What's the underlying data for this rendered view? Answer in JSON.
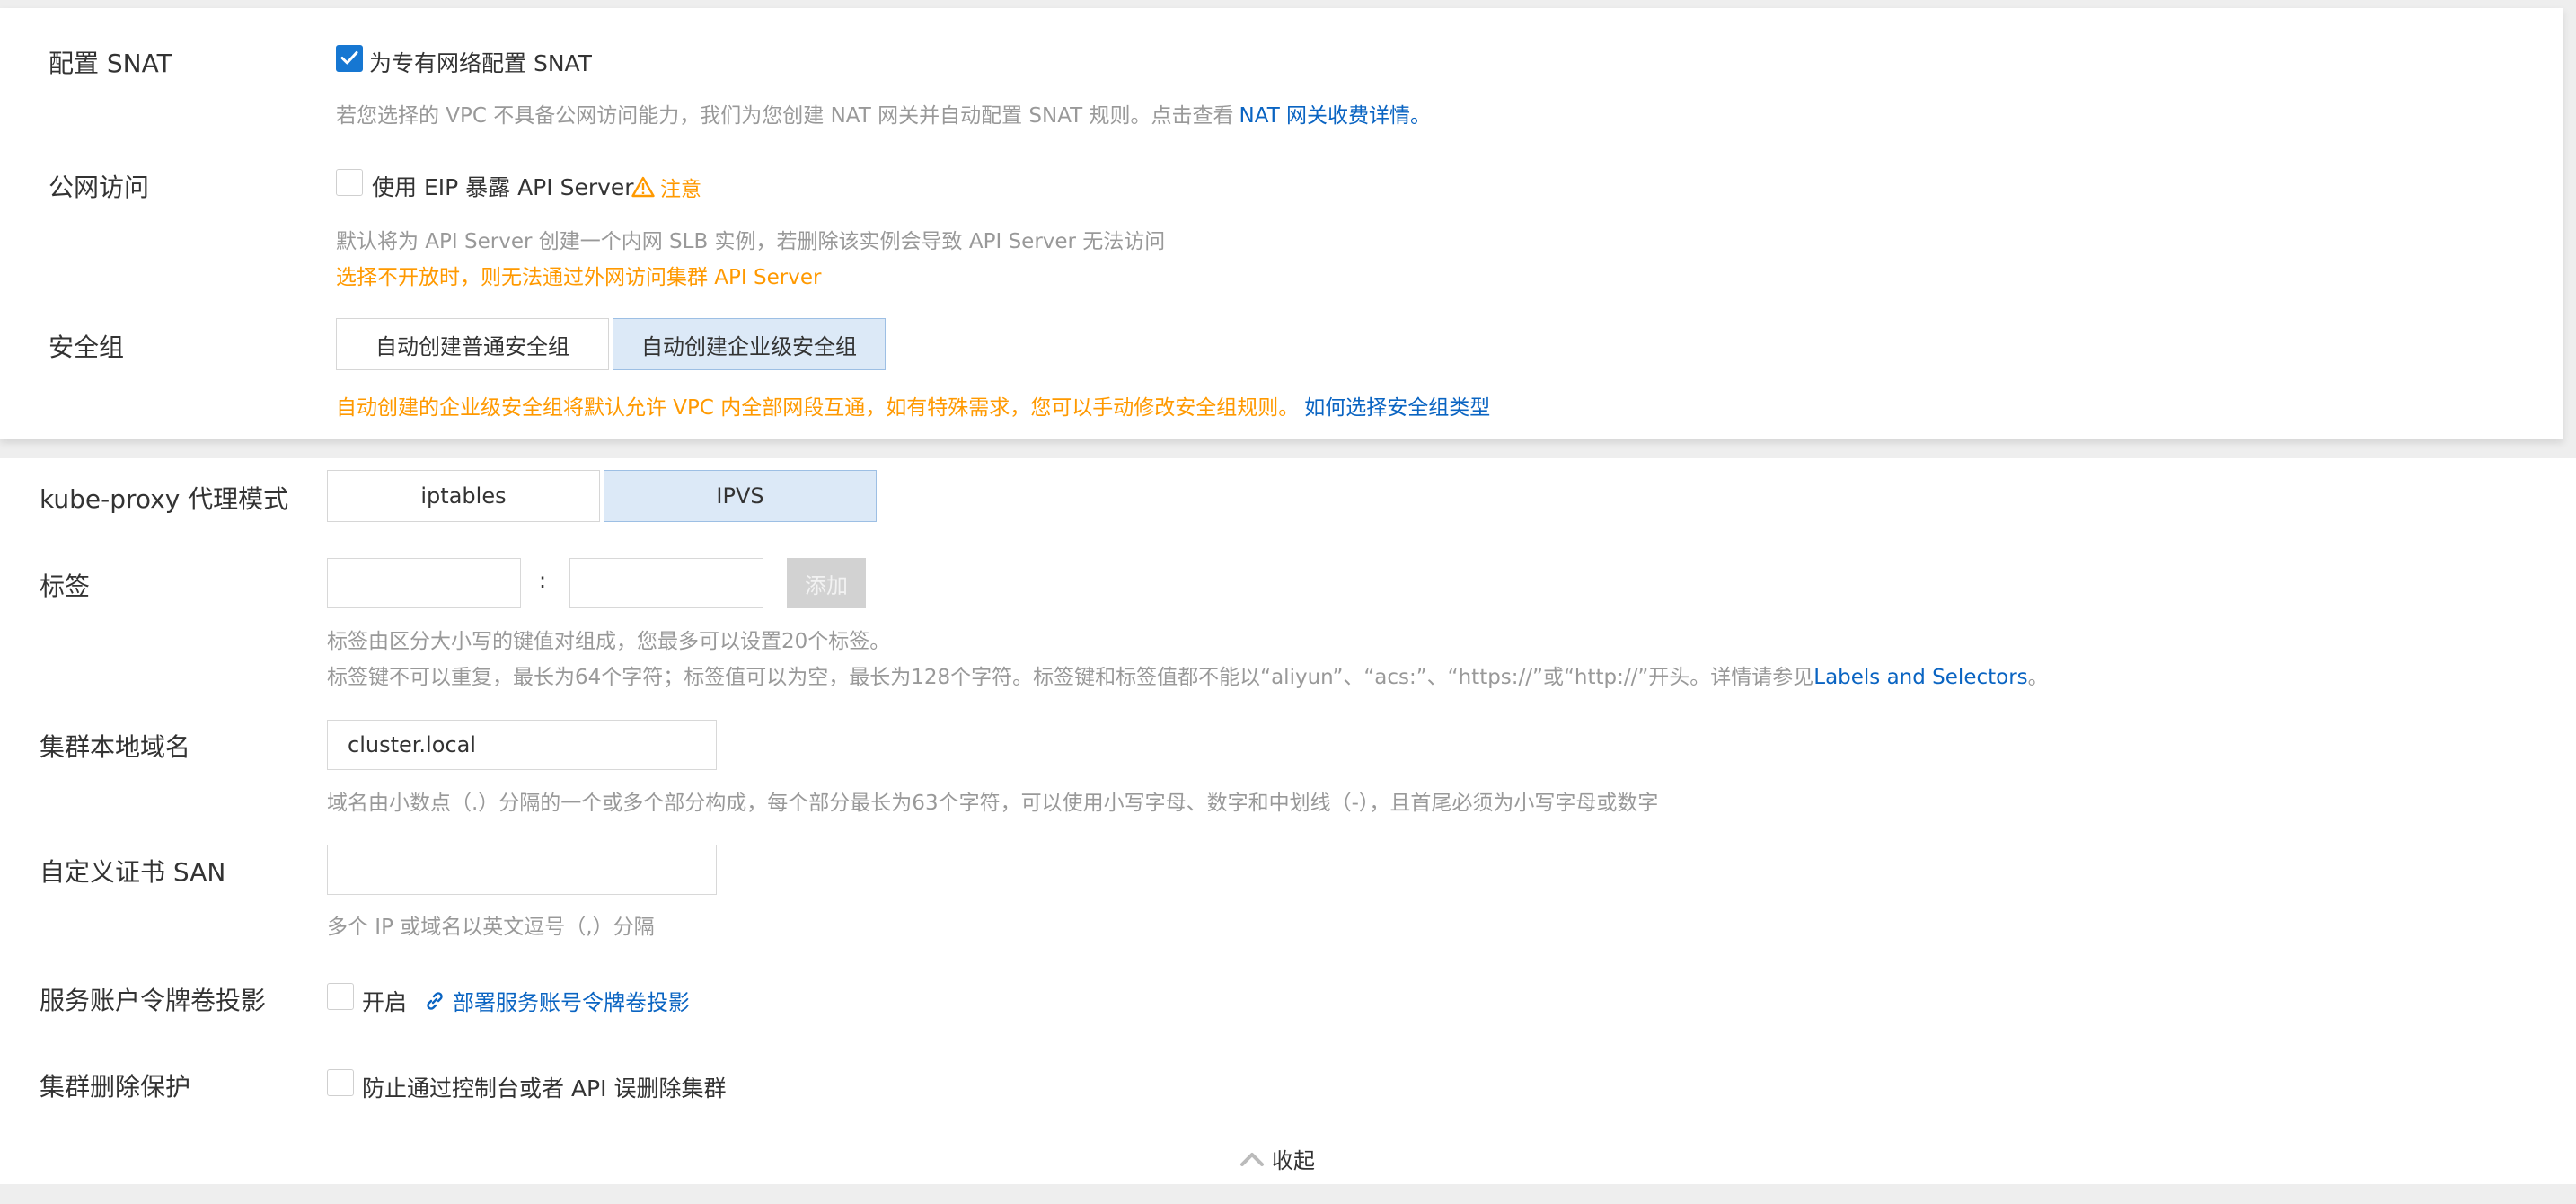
{
  "snat": {
    "label": "配置 SNAT",
    "checkbox_text": "为专有网络配置 SNAT",
    "checked": true,
    "help_text": "若您选择的 VPC 不具备公网访问能力，我们为您创建 NAT 网关并自动配置 SNAT 规则。点击查看",
    "help_link": "NAT 网关收费详情。"
  },
  "public_access": {
    "label": "公网访问",
    "checkbox_text": "使用 EIP 暴露 API Server",
    "checked": false,
    "warning_link": "注意",
    "help_text": "默认将为 API Server 创建一个内网 SLB 实例，若删除该实例会导致 API Server 无法访问",
    "warning_text": "选择不开放时，则无法通过外网访问集群 API Server"
  },
  "security_group": {
    "label": "安全组",
    "options": [
      "自动创建普通安全组",
      "自动创建企业级安全组"
    ],
    "selected": "自动创建企业级安全组",
    "warning_text": "自动创建的企业级安全组将默认允许 VPC 内全部网段互通，如有特殊需求，您可以手动修改安全组规则。",
    "help_link": "如何选择安全组类型"
  },
  "kube_proxy": {
    "label": "kube-proxy 代理模式",
    "options": [
      "iptables",
      "IPVS"
    ],
    "selected": "IPVS"
  },
  "tags": {
    "label": "标签",
    "key_value": "",
    "value_value": "",
    "separator": ":",
    "add_button": "添加",
    "help_line1": "标签由区分大小写的键值对组成，您最多可以设置20个标签。",
    "help_line2": "标签键不可以重复，最长为64个字符；标签值可以为空，最长为128个字符。标签键和标签值都不能以“aliyun”、“acs:”、“https://”或“http://”开头。详情请参见",
    "help_link": "Labels and Selectors",
    "help_end": "。"
  },
  "cluster_domain": {
    "label": "集群本地域名",
    "value": "cluster.local",
    "help_text": "域名由小数点（.）分隔的一个或多个部分构成，每个部分最长为63个字符，可以使用小写字母、数字和中划线（-），且首尾必须为小写字母或数字"
  },
  "cert_san": {
    "label": "自定义证书 SAN",
    "value": "",
    "help_text": "多个 IP 或域名以英文逗号（,）分隔"
  },
  "sa_token": {
    "label": "服务账户令牌卷投影",
    "checkbox_text": "开启",
    "checked": false,
    "link_text": "部署服务账号令牌卷投影"
  },
  "delete_protection": {
    "label": "集群删除保护",
    "checkbox_text": "防止通过控制台或者 API 误删除集群",
    "checked": false
  },
  "collapse": {
    "label": "收起"
  },
  "colors": {
    "primary": "#1677d2",
    "link": "#0a64c2",
    "warning": "#ff9900",
    "help_text": "#999999",
    "selected_bg": "#dce9f7"
  },
  "icons": {
    "checkmark": "check-icon",
    "warning": "warning-triangle-icon",
    "link": "link-icon",
    "collapse": "chevron-up-icon"
  }
}
